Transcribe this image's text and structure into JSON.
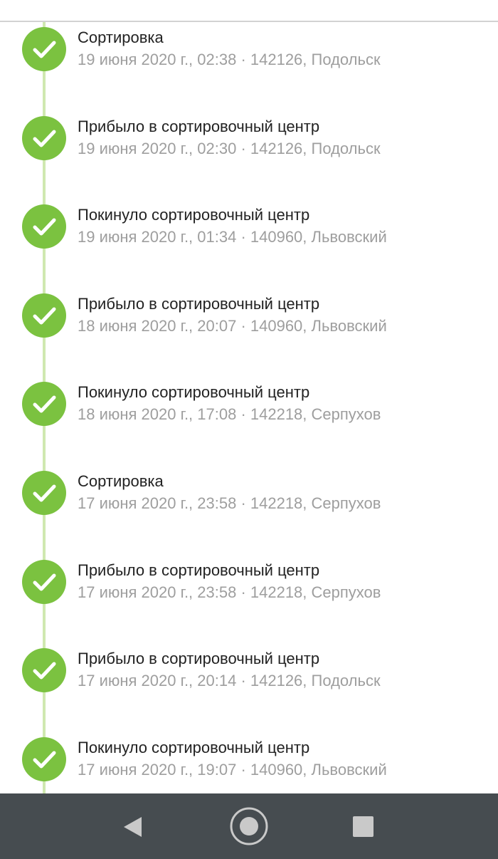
{
  "tracking": {
    "events": [
      {
        "title": "Сортировка",
        "details": "19 июня 2020 г., 02:38 · 142126, Подольск"
      },
      {
        "title": "Прибыло в сортировочный центр",
        "details": "19 июня 2020 г., 02:30 · 142126, Подольск"
      },
      {
        "title": "Покинуло сортировочный центр",
        "details": "19 июня 2020 г., 01:34 · 140960, Львовский"
      },
      {
        "title": "Прибыло в сортировочный центр",
        "details": "18 июня 2020 г., 20:07 · 140960, Львовский"
      },
      {
        "title": "Покинуло сортировочный центр",
        "details": "18 июня 2020 г., 17:08 · 142218, Серпухов"
      },
      {
        "title": "Сортировка",
        "details": "17 июня 2020 г., 23:58 · 142218, Серпухов"
      },
      {
        "title": "Прибыло в сортировочный центр",
        "details": "17 июня 2020 г., 23:58 · 142218, Серпухов"
      },
      {
        "title": "Прибыло в сортировочный центр",
        "details": "17 июня 2020 г., 20:14 · 142126, Подольск"
      },
      {
        "title": "Покинуло сортировочный центр",
        "details": "17 июня 2020 г., 19:07 · 140960, Львовский"
      }
    ],
    "status_icon": "check-icon",
    "colors": {
      "check_circle": "#7bc240",
      "timeline": "#cfe8b0",
      "title_text": "#222222",
      "details_text": "#9e9e9e",
      "nav_bar": "#464c50"
    }
  },
  "system_nav": {
    "back_icon": "back-triangle-icon",
    "home_icon": "home-circle-icon",
    "recents_icon": "recents-square-icon"
  }
}
